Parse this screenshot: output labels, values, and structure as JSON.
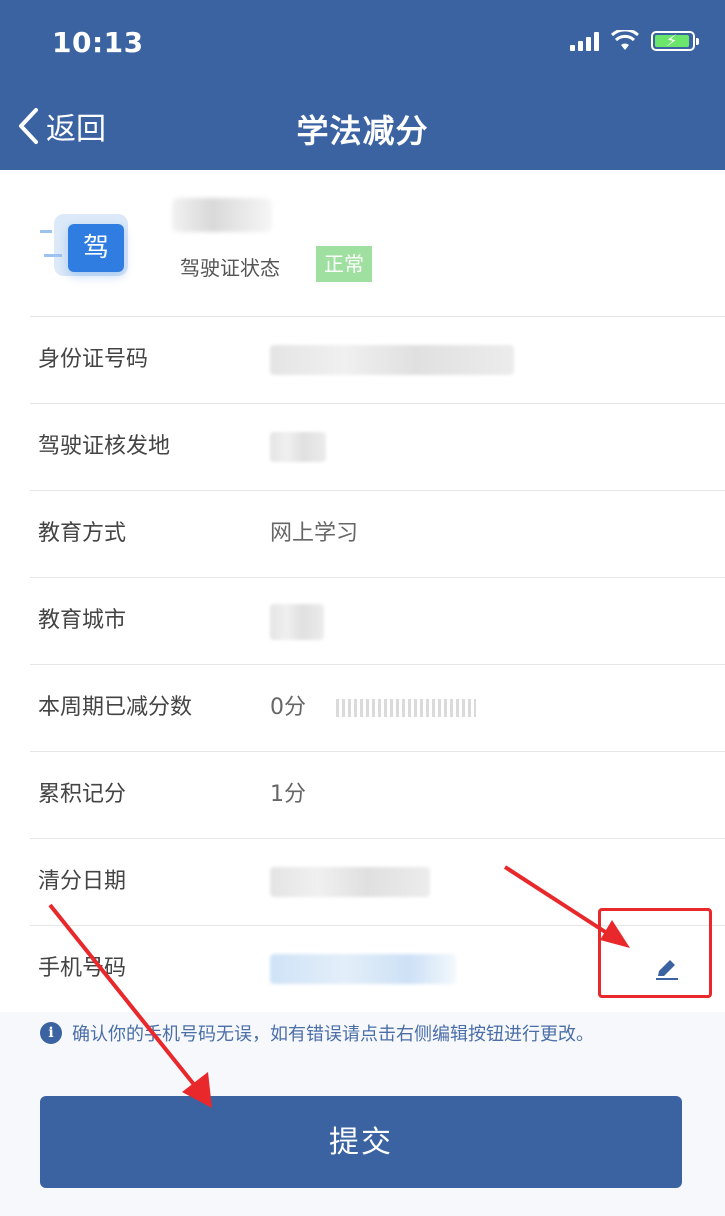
{
  "status_bar": {
    "time": "10:13"
  },
  "nav": {
    "back_label": "返回",
    "title": "学法减分"
  },
  "profile": {
    "status_label": "驾驶证状态",
    "status_value": "正常",
    "license_icon_text": "驾"
  },
  "rows": [
    {
      "label": "身份证号码",
      "value": ""
    },
    {
      "label": "驾驶证核发地",
      "value": ""
    },
    {
      "label": "教育方式",
      "value": "网上学习"
    },
    {
      "label": "教育城市",
      "value": ""
    },
    {
      "label": "本周期已减分数",
      "value": "0分"
    },
    {
      "label": "累积记分",
      "value": "1分"
    },
    {
      "label": "清分日期",
      "value": ""
    },
    {
      "label": "手机号码",
      "value": ""
    }
  ],
  "info_text": "确认你的手机号码无误，如有错误请点击右侧编辑按钮进行更改。",
  "submit_label": "提交",
  "colors": {
    "primary": "#3b63a2",
    "badge": "#9fe0a0",
    "annotation": "#e8282b"
  }
}
